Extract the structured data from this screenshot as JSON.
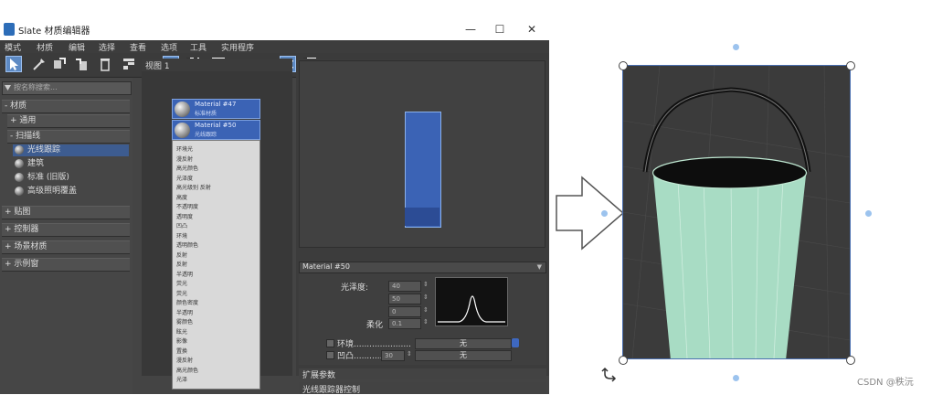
{
  "window": {
    "title": "Slate 材质编辑器",
    "minimize": "—",
    "maximize": "☐",
    "close": "✕"
  },
  "menu": [
    "模式",
    "材质",
    "编辑",
    "选择",
    "查看",
    "选项",
    "工具",
    "实用程序"
  ],
  "browser": {
    "search_placeholder": "按名称搜索...",
    "groups": {
      "materials": "- 材质",
      "general": "+ 通用",
      "scanline": "- 扫描线",
      "maps": "+ 贴图",
      "controllers": "+ 控制器",
      "scene_materials": "+ 场景材质",
      "sample_slots": "+ 示例窗"
    },
    "scanline_items": [
      "光线跟踪",
      "建筑",
      "标准 (旧版)",
      "高级照明覆盖"
    ],
    "selected_item": "光线跟踪"
  },
  "view": {
    "tab_label": "视图 1",
    "nodes": [
      {
        "name": "Material #47",
        "subtitle": "标准材质"
      },
      {
        "name": "Material #50",
        "subtitle": "光线跟踪"
      }
    ],
    "slots": [
      "环境光",
      "漫反射",
      "高光颜色",
      "光泽度",
      "高光级别 反射",
      "高度",
      "不透明度",
      "透明度",
      "凹凸",
      "环境",
      "透明颜色",
      "反射",
      "反射",
      "半透明",
      "荧光",
      "荧光",
      "颜色密度",
      "半透明",
      "雾颜色",
      "眩光",
      "影像",
      "置换",
      "漫反射",
      "高光颜色",
      "光泽"
    ]
  },
  "param_editor": {
    "header": "Material #50",
    "gloss_label": "光泽度:",
    "gloss_value": "40",
    "val2": "50",
    "val3": "0",
    "soften_label": "柔化",
    "soften_value": "0.1",
    "env_label": "环境......................",
    "env_map": "无",
    "bump_label": "凹凸...........",
    "bump_value": "30",
    "bump_map": "无",
    "expand_params": "扩展参数",
    "raytracer_controls": "光线跟踪器控制"
  },
  "watermark": "CSDN @秩沅",
  "colors": {
    "accent": "#3b63b5",
    "bucket": "#a8dcc4",
    "viewport_bg": "#3b3b3b"
  }
}
